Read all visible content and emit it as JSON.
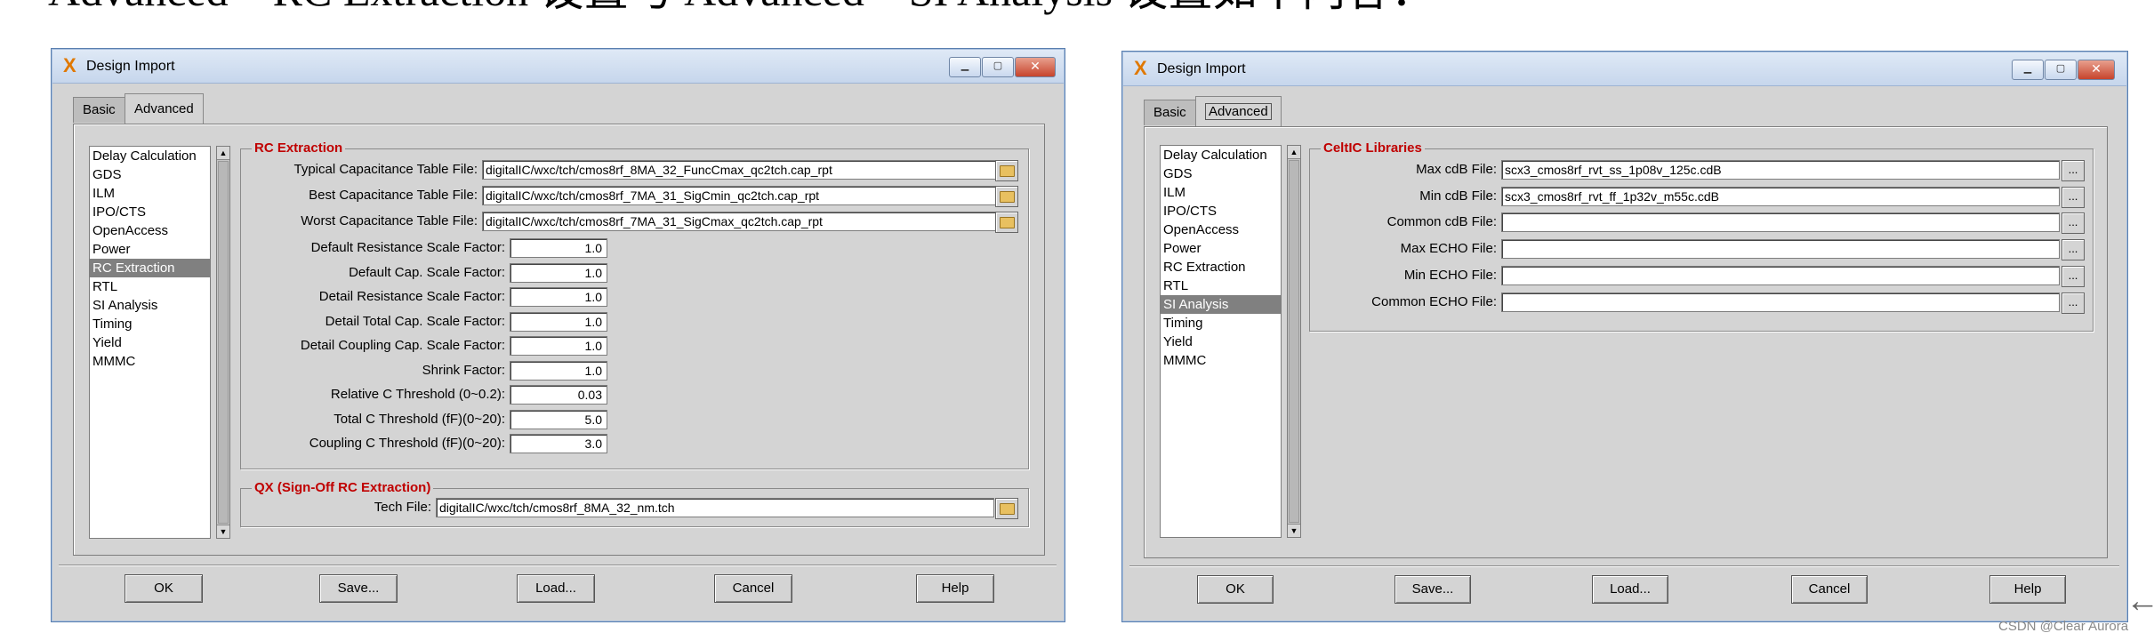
{
  "heading": "Advanced – RC Extraction 设置与 Advanced – SI Analysis 设置如下内容：",
  "windows": [
    {
      "title": "Design Import",
      "tabs": [
        "Basic",
        "Advanced"
      ],
      "list": [
        "Delay Calculation",
        "GDS",
        "ILM",
        "IPO/CTS",
        "OpenAccess",
        "Power",
        "RC Extraction",
        "RTL",
        "SI Analysis",
        "Timing",
        "Yield",
        "MMMC"
      ],
      "selected": "RC Extraction",
      "group1_title": "RC Extraction",
      "file_rows": [
        {
          "label": "Typical Capacitance Table File:",
          "value": "digitalIC/wxc/tch/cmos8rf_8MA_32_FuncCmax_qc2tch.cap_rpt"
        },
        {
          "label": "Best Capacitance Table File:",
          "value": "digitalIC/wxc/tch/cmos8rf_7MA_31_SigCmin_qc2tch.cap_rpt"
        },
        {
          "label": "Worst Capacitance Table File:",
          "value": "digitalIC/wxc/tch/cmos8rf_7MA_31_SigCmax_qc2tch.cap_rpt"
        }
      ],
      "num_rows": [
        {
          "label": "Default Resistance Scale Factor:",
          "value": "1.0"
        },
        {
          "label": "Default Cap. Scale Factor:",
          "value": "1.0"
        },
        {
          "label": "Detail Resistance Scale Factor:",
          "value": "1.0"
        },
        {
          "label": "Detail Total Cap. Scale Factor:",
          "value": "1.0"
        },
        {
          "label": "Detail Coupling Cap. Scale Factor:",
          "value": "1.0"
        },
        {
          "label": "Shrink Factor:",
          "value": "1.0"
        },
        {
          "label": "Relative C Threshold (0~0.2):",
          "value": "0.03"
        },
        {
          "label": "Total C Threshold (fF)(0~20):",
          "value": "5.0"
        },
        {
          "label": "Coupling C Threshold (fF)(0~20):",
          "value": "3.0"
        }
      ],
      "group2_title": "QX (Sign-Off RC Extraction)",
      "tech_label": "Tech File:",
      "tech_value": "digitalIC/wxc/tch/cmos8rf_8MA_32_nm.tch",
      "buttons": [
        "OK",
        "Save...",
        "Load...",
        "Cancel",
        "Help"
      ]
    },
    {
      "title": "Design Import",
      "tabs": [
        "Basic",
        "Advanced"
      ],
      "list": [
        "Delay Calculation",
        "GDS",
        "ILM",
        "IPO/CTS",
        "OpenAccess",
        "Power",
        "RC Extraction",
        "RTL",
        "SI Analysis",
        "Timing",
        "Yield",
        "MMMC"
      ],
      "selected": "SI Analysis",
      "group1_title": "CeltIC Libraries",
      "file_rows": [
        {
          "label": "Max cdB File:",
          "value": "scx3_cmos8rf_rvt_ss_1p08v_125c.cdB"
        },
        {
          "label": "Min cdB File:",
          "value": "scx3_cmos8rf_rvt_ff_1p32v_m55c.cdB"
        },
        {
          "label": "Common cdB File:",
          "value": ""
        },
        {
          "label": "Max ECHO File:",
          "value": ""
        },
        {
          "label": "Min ECHO File:",
          "value": ""
        },
        {
          "label": "Common ECHO File:",
          "value": ""
        }
      ],
      "browse_label": "...",
      "buttons": [
        "OK",
        "Save...",
        "Load...",
        "Cancel",
        "Help"
      ]
    }
  ],
  "watermark": "CSDN @Clear Aurora",
  "colors": {
    "group_title": "#c00000",
    "selection": "#808080",
    "titlebar": "#c6d6ec"
  }
}
